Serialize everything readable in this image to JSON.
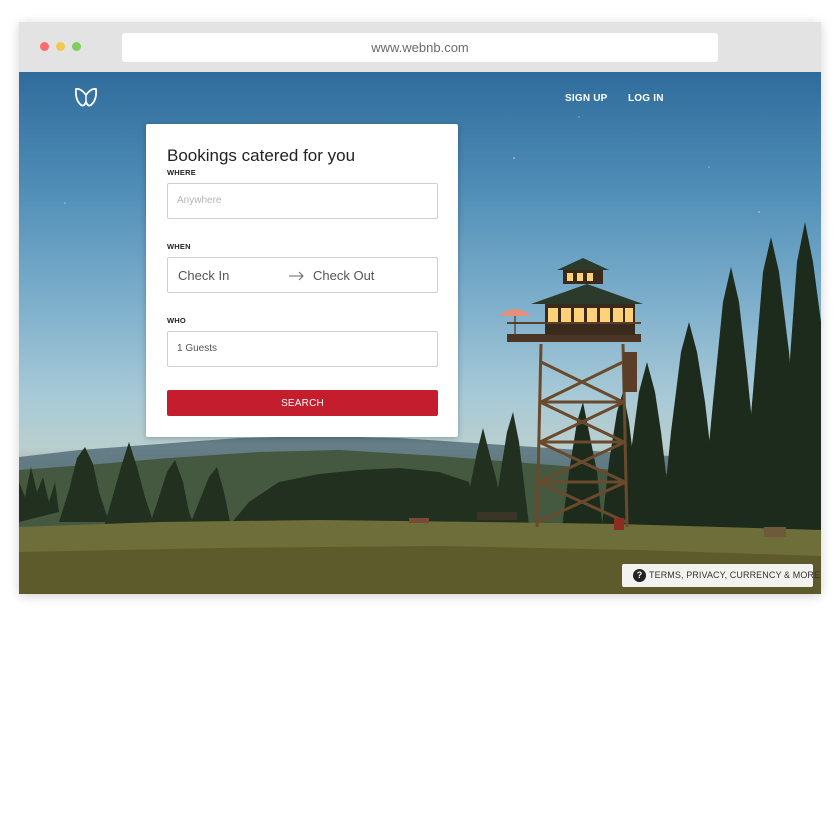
{
  "browser": {
    "url": "www.webnb.com"
  },
  "header": {
    "logo_icon": "webnb-logo-icon",
    "nav": {
      "signup": "SIGN UP",
      "login": "LOG IN"
    }
  },
  "booking": {
    "title": "Bookings catered for you",
    "where_label": "WHERE",
    "where_placeholder": "Anywhere",
    "when_label": "WHEN",
    "check_in": "Check In",
    "check_out": "Check Out",
    "arrow_icon": "arrow-right-icon",
    "who_label": "WHO",
    "guests_value": "1 Guests",
    "search_label": "SEARCH"
  },
  "footer": {
    "help_icon": "question-circle-icon",
    "help_glyph": "?",
    "links_text": "TERMS, PRIVACY, CURRENCY & MORE"
  },
  "colors": {
    "accent": "#c41e2e",
    "window_chrome": "#e3e3e3",
    "dot_red": "#ff6b6b",
    "dot_yellow": "#f2c94c",
    "dot_green": "#7ccf5b"
  }
}
